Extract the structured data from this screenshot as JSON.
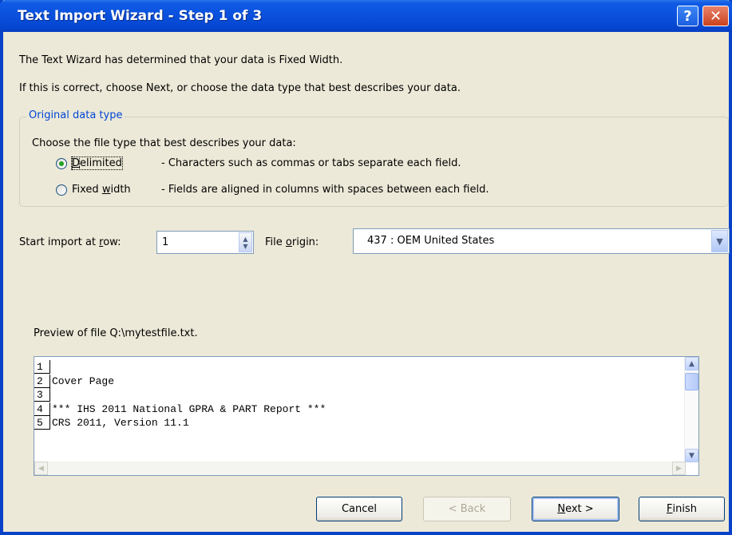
{
  "window": {
    "title": "Text Import Wizard - Step 1 of 3",
    "help": "?",
    "close": "✕"
  },
  "message1": "The Text Wizard has determined that your data is Fixed Width.",
  "message2": "If this is correct, choose Next, or choose the data type that best describes your data.",
  "group": {
    "legend": "Original data type",
    "prompt": "Choose the file type that best describes your data:",
    "options": [
      {
        "label_pre": "",
        "label_u": "D",
        "label_post": "elimited",
        "desc": "- Characters such as commas or tabs separate each field.",
        "selected": true
      },
      {
        "label_pre": "Fixed ",
        "label_u": "w",
        "label_post": "idth",
        "desc": "- Fields are aligned in columns with spaces between each field.",
        "selected": false
      }
    ]
  },
  "start_row": {
    "label_pre": "Start import at ",
    "label_u": "r",
    "label_post": "ow:",
    "value": "1"
  },
  "file_origin": {
    "label_pre": "File ",
    "label_u": "o",
    "label_post": "rigin:",
    "value": "437 : OEM United States"
  },
  "preview": {
    "label": "Preview of file Q:\\mytestfile.txt.",
    "lines": [
      {
        "num": "1",
        "text": ""
      },
      {
        "num": "2",
        "text": "Cover Page"
      },
      {
        "num": "3",
        "text": ""
      },
      {
        "num": "4",
        "text": "*** IHS 2011 National GPRA & PART Report ***"
      },
      {
        "num": "5",
        "text": "CRS 2011, Version 11.1"
      }
    ]
  },
  "buttons": {
    "cancel": "Cancel",
    "back": "< Back",
    "next_u": "N",
    "next_post": "ext >",
    "finish_u": "F",
    "finish_post": "inish"
  }
}
